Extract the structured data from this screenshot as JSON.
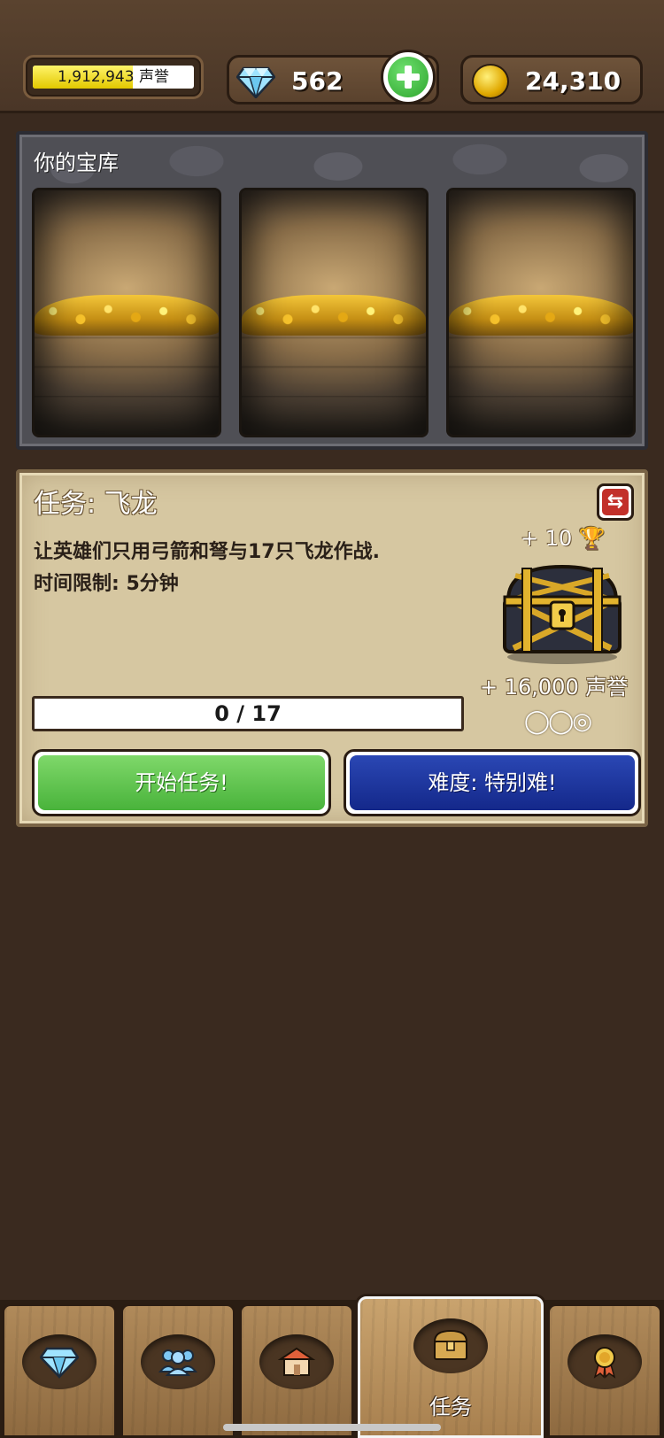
{
  "header": {
    "fame_text": "1,912,943 声誉",
    "fame_progress": 0.62,
    "gems": "562",
    "gold": "24,310",
    "icons": {
      "gem": "diamond-icon",
      "add": "plus-icon",
      "gold": "gold-coin-icon"
    }
  },
  "vault": {
    "title": "你的宝库",
    "slots": [
      {
        "icon": "treasure-pile-icon"
      },
      {
        "icon": "treasure-pile-icon"
      },
      {
        "icon": "treasure-pile-icon"
      }
    ]
  },
  "quest": {
    "title": "任务: 飞龙",
    "description_line1": "让英雄们只用弓箭和弩与17只飞龙作战.",
    "description_line2": "时间限制: 5分钟",
    "reward_cups": "+ 10",
    "reward_fame": "+ 16,000 声誉",
    "difficulty_marks": "◯◯◎",
    "progress_text": "0 / 17",
    "progress_value": 0,
    "progress_max": 17,
    "start_label": "开始任务!",
    "difficulty_label": "难度: 特别难!",
    "icons": {
      "swap": "swap-icon",
      "cup": "trophy-icon",
      "chest": "treasure-chest-icon"
    }
  },
  "nav": {
    "tabs": [
      {
        "icon": "diamond-icon",
        "label": ""
      },
      {
        "icon": "heroes-icon",
        "label": ""
      },
      {
        "icon": "home-icon",
        "label": ""
      },
      {
        "icon": "chest-icon",
        "label": "任务",
        "active": true
      },
      {
        "icon": "medal-icon",
        "label": ""
      }
    ]
  },
  "colors": {
    "background": "#3a2a1f",
    "start_button": "#49b33b",
    "difficulty_button": "#14288a",
    "quest_panel": "#d6c7a1"
  }
}
